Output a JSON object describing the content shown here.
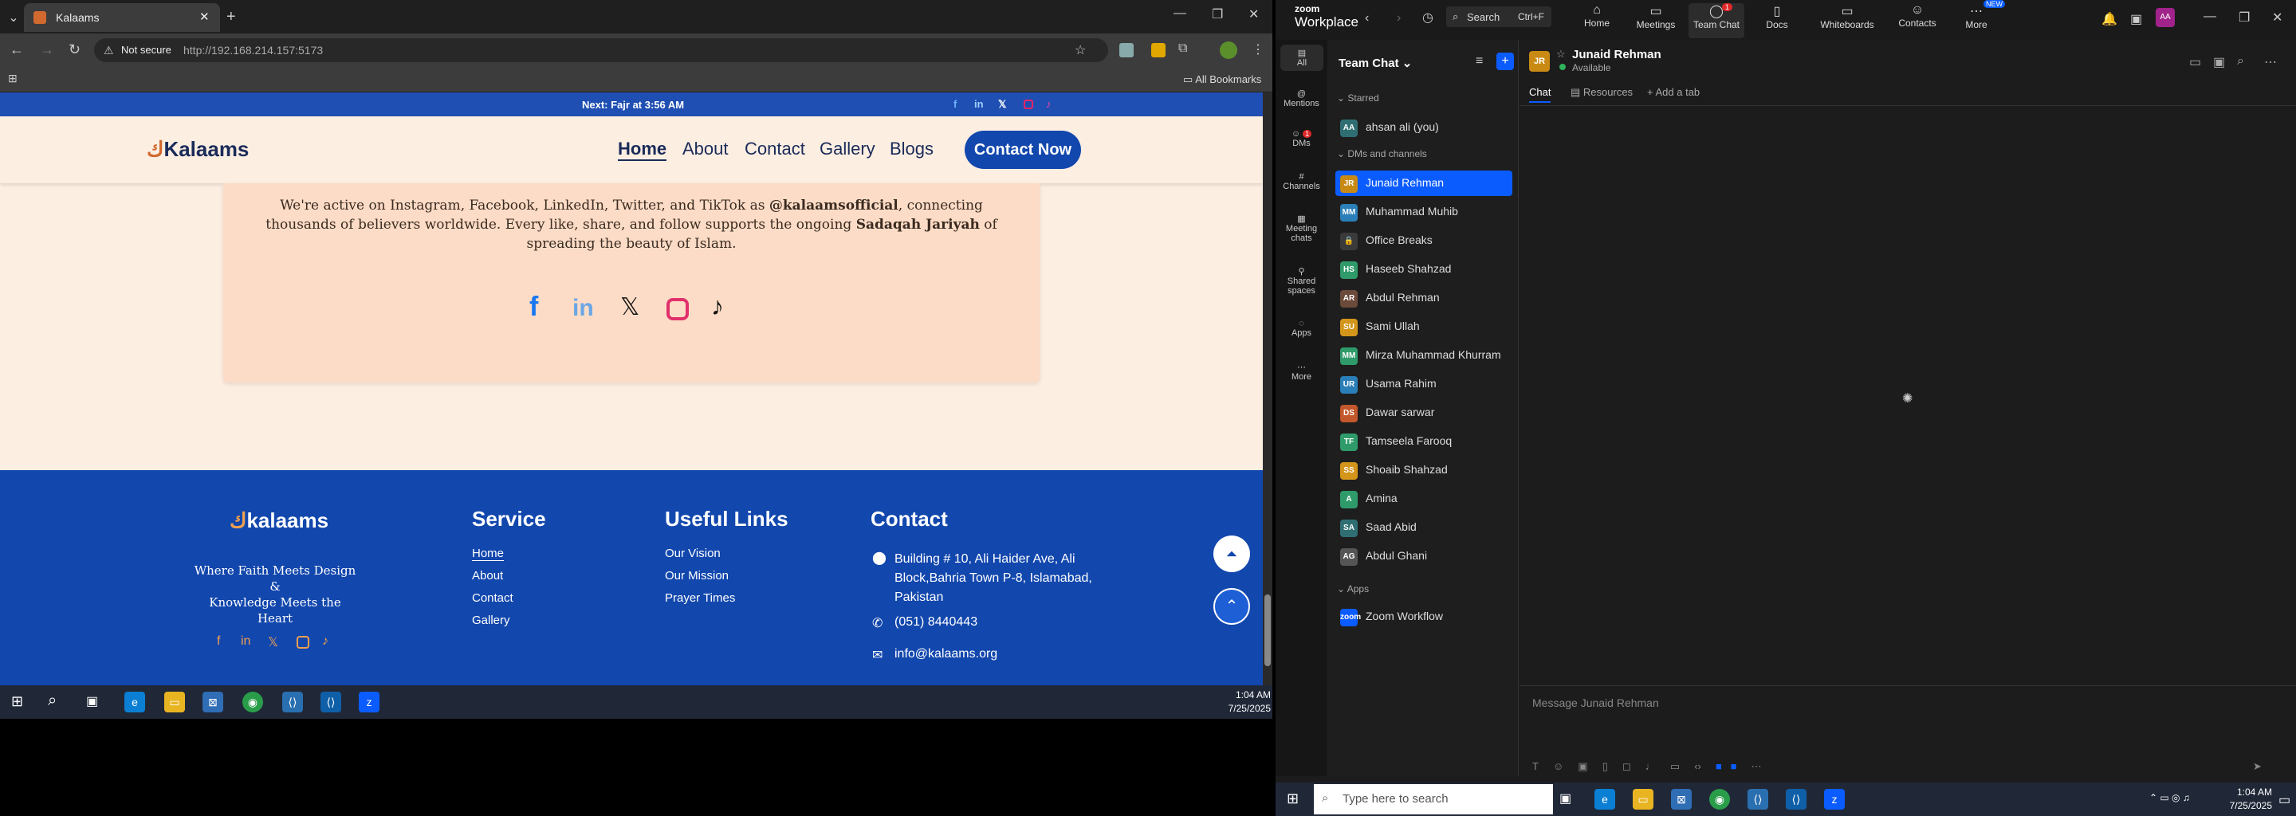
{
  "browser": {
    "tab_title": "Kalaams",
    "url_security": "Not secure",
    "url": "http://192.168.214.157:5173",
    "bookmarks_label": "All Bookmarks"
  },
  "site": {
    "top_strip": "Next: Fajr at 3:56 AM",
    "logo": "Kalaams",
    "nav": [
      "Home",
      "About",
      "Contact",
      "Gallery",
      "Blogs"
    ],
    "cta": "Contact Now",
    "card_text_1": "We're active on Instagram, Facebook, LinkedIn, Twitter, and TikTok as",
    "card_handle": "@kalaamsofficial",
    "card_text_2": ", connecting",
    "card_text_3": "thousands of believers worldwide. Every like, share, and follow supports the ongoing",
    "card_bold": "Sadaqah Jariyah",
    "card_text_4": "of",
    "card_text_5": "spreading the beauty of Islam.",
    "footer": {
      "logo": "kalaams",
      "tagline_1": "Where Faith Meets Design",
      "tagline_2": "&",
      "tagline_3": "Knowledge Meets the Heart",
      "service_title": "Service",
      "service_links": [
        "Home",
        "About",
        "Contact",
        "Gallery"
      ],
      "useful_title": "Useful Links",
      "useful_links": [
        "Our Vision",
        "Our Mission",
        "Prayer Times"
      ],
      "contact_title": "Contact",
      "address_1": "Building # 10, Ali Haider Ave, Ali",
      "address_2": "Block,Bahria Town P-8, Islamabad,",
      "address_3": "Pakistan",
      "phone": "(051) 8440443",
      "email": "info@kalaams.org"
    }
  },
  "left_taskbar": {
    "time": "1:04 AM",
    "date": "7/25/2025"
  },
  "zoom": {
    "brand_1": "zoom",
    "brand_2": "Workplace",
    "search": "Search",
    "search_shortcut": "Ctrl+F",
    "nav": [
      {
        "label": "Home",
        "badge": ""
      },
      {
        "label": "Meetings",
        "badge": ""
      },
      {
        "label": "Team Chat",
        "badge": "1"
      },
      {
        "label": "Docs",
        "badge": ""
      },
      {
        "label": "Whiteboards",
        "badge": ""
      },
      {
        "label": "Contacts",
        "badge": ""
      },
      {
        "label": "More",
        "badge": "NEW"
      }
    ],
    "avatar": "AA",
    "rail": [
      {
        "label": "All",
        "badge": ""
      },
      {
        "label": "Mentions",
        "badge": ""
      },
      {
        "label": "DMs",
        "badge": "1"
      },
      {
        "label": "Channels",
        "badge": ""
      },
      {
        "label": "Meeting chats",
        "badge": ""
      },
      {
        "label": "Shared spaces",
        "badge": ""
      },
      {
        "label": "Apps",
        "badge": ""
      },
      {
        "label": "More",
        "badge": ""
      }
    ],
    "sidebar_title": "Team Chat",
    "section_starred": "Starred",
    "starred": [
      {
        "initials": "AA",
        "name": "ahsan ali (you)",
        "color": "#2f6f73"
      }
    ],
    "section_dms": "DMs and channels",
    "dms": [
      {
        "initials": "JR",
        "name": "Junaid Rehman",
        "color": "#c98a14"
      },
      {
        "initials": "MM",
        "name": "Muhammad Muhib",
        "color": "#2b7fb8"
      },
      {
        "initials": "🔒",
        "name": "Office Breaks",
        "color": "#3a3a3a"
      },
      {
        "initials": "HS",
        "name": "Haseeb Shahzad",
        "color": "#2f9b6a"
      },
      {
        "initials": "AR",
        "name": "Abdul Rehman",
        "color": "#6b4a3a"
      },
      {
        "initials": "SU",
        "name": "Sami Ullah",
        "color": "#d4951b"
      },
      {
        "initials": "MM",
        "name": "Mirza Muhammad Khurram",
        "color": "#2f9b6a"
      },
      {
        "initials": "UR",
        "name": "Usama Rahim",
        "color": "#2b7fb8"
      },
      {
        "initials": "DS",
        "name": "Dawar sarwar",
        "color": "#c2572b"
      },
      {
        "initials": "TF",
        "name": "Tamseela Farooq",
        "color": "#2f9b6a"
      },
      {
        "initials": "SS",
        "name": "Shoaib Shahzad",
        "color": "#d4951b"
      },
      {
        "initials": "A",
        "name": "Amina",
        "color": "#2f9b6a"
      },
      {
        "initials": "SA",
        "name": "Saad Abid",
        "color": "#2f6f73"
      },
      {
        "initials": "AG",
        "name": "Abdul Ghani",
        "color": "#555"
      }
    ],
    "section_apps": "Apps",
    "apps": [
      {
        "initials": "zoom",
        "name": "Zoom Workflow",
        "color": "#0b5cff"
      }
    ],
    "chat_header": {
      "initials": "JR",
      "name": "Junaid Rehman",
      "status": "Available"
    },
    "tabs": [
      "Chat",
      "Resources",
      "Add a tab"
    ],
    "composer_placeholder": "Message Junaid Rehman"
  },
  "right_taskbar": {
    "search": "Type here to search",
    "time": "1:04 AM",
    "date": "7/25/2025"
  }
}
